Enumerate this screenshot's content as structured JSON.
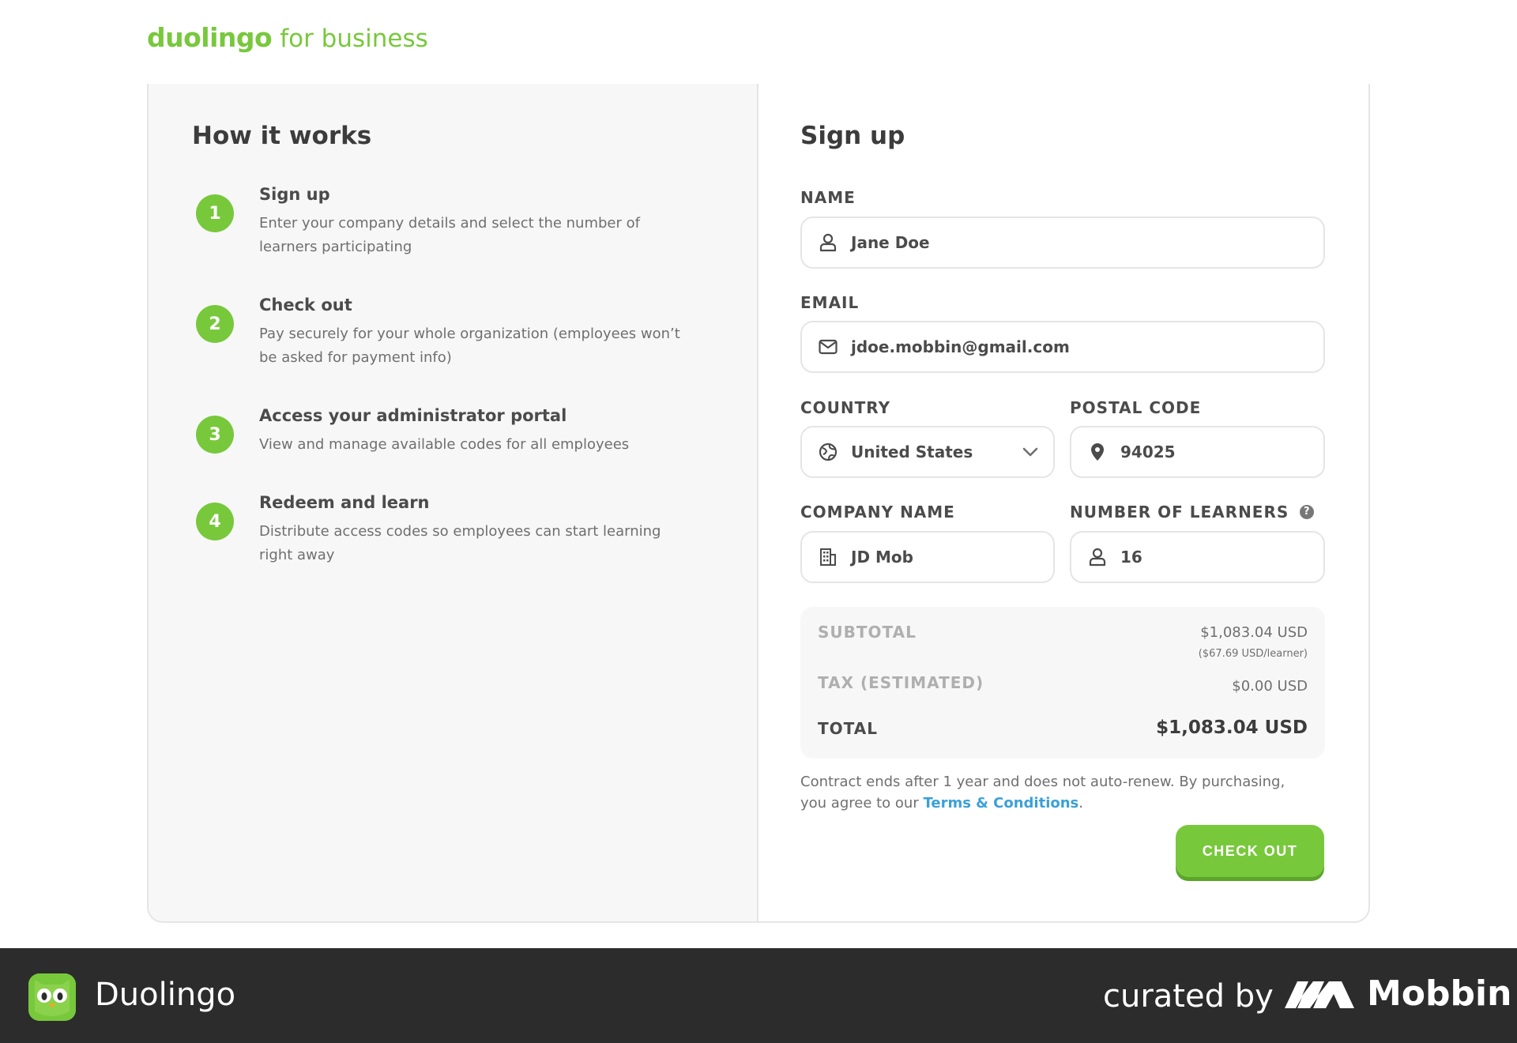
{
  "header": {
    "brand": "duolingo",
    "brand_suffix": "for business"
  },
  "how_it_works": {
    "title": "How it works",
    "steps": [
      {
        "number": "1",
        "title": "Sign up",
        "description": "Enter your company details and select the number of learners participating"
      },
      {
        "number": "2",
        "title": "Check out",
        "description": "Pay securely for your whole organization (employees won’t be asked for payment info)"
      },
      {
        "number": "3",
        "title": "Access your administrator portal",
        "description": "View and manage available codes for all employees"
      },
      {
        "number": "4",
        "title": "Redeem and learn",
        "description": "Distribute access codes so employees can start learning right away"
      }
    ]
  },
  "signup": {
    "title": "Sign up",
    "name": {
      "label": "NAME",
      "value": "Jane Doe",
      "icon": "person-icon"
    },
    "email": {
      "label": "EMAIL",
      "value": "jdoe.mobbin@gmail.com",
      "icon": "envelope-icon"
    },
    "country": {
      "label": "COUNTRY",
      "value": "United States",
      "icon": "globe-icon"
    },
    "postal_code": {
      "label": "POSTAL CODE",
      "value": "94025",
      "icon": "location-pin-icon"
    },
    "company_name": {
      "label": "COMPANY NAME",
      "value": "JD Mob",
      "icon": "building-icon"
    },
    "learners": {
      "label": "NUMBER OF LEARNERS",
      "value": "16",
      "icon": "person-icon",
      "help": "?"
    }
  },
  "summary": {
    "subtotal_label": "SUBTOTAL",
    "subtotal_value": "$1,083.04 USD",
    "per_learner": "($67.69 USD/learner)",
    "tax_label": "TAX (ESTIMATED)",
    "tax_value": "$0.00 USD",
    "total_label": "TOTAL",
    "total_value": "$1,083.04 USD"
  },
  "contract": {
    "text": "Contract ends after 1 year and does not auto-renew. By purchasing, you agree to our ",
    "link": "Terms & Conditions",
    "end": "."
  },
  "checkout_label": "CHECK OUT",
  "footer": {
    "app_name": "Duolingo",
    "curated_by": "curated by",
    "brand": "Mobbin"
  },
  "colors": {
    "accent": "#78c83c",
    "link": "#3ba0d8",
    "footer_bg": "#2c2c2c"
  }
}
